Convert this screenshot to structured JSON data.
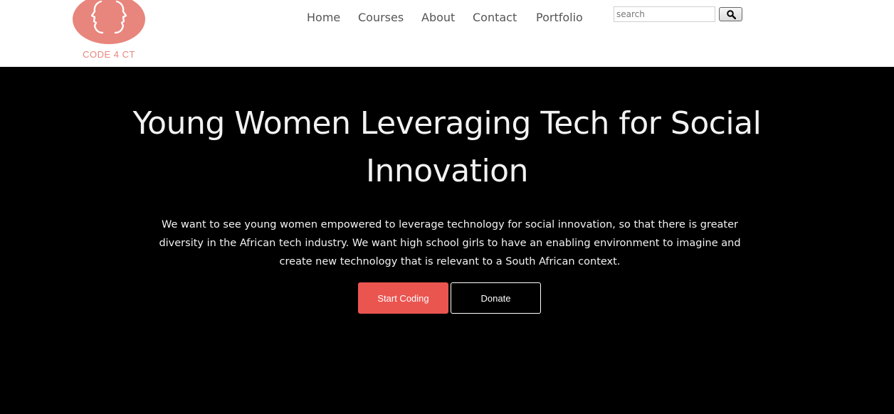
{
  "logo": {
    "text": "CODE 4 CT",
    "color": "#e8857c",
    "icon": "face-profiles-logo-icon"
  },
  "nav": {
    "links": [
      {
        "label": "Home"
      },
      {
        "label": "Courses"
      },
      {
        "label": "About"
      },
      {
        "label": "Contact"
      },
      {
        "label": "Portfolio"
      }
    ]
  },
  "search": {
    "placeholder": "search",
    "value": "",
    "button_icon": "search-icon"
  },
  "hero": {
    "title_line1": "Young Women Leveraging Tech for Social",
    "title_line2": "Innovation",
    "description_line1": "We want to see young women empowered to leverage technology for social innovation, so that there is greater",
    "description_line2": "diversity in the African tech industry. We want high school girls to have an enabling environment to imagine and",
    "description_line3": "create new technology that is relevant to a South African context.",
    "start_button": "Start Coding",
    "donate_button": "Donate"
  },
  "colors": {
    "accent": "#ea5550",
    "background": "#000000",
    "text": "#f2f2f2"
  }
}
